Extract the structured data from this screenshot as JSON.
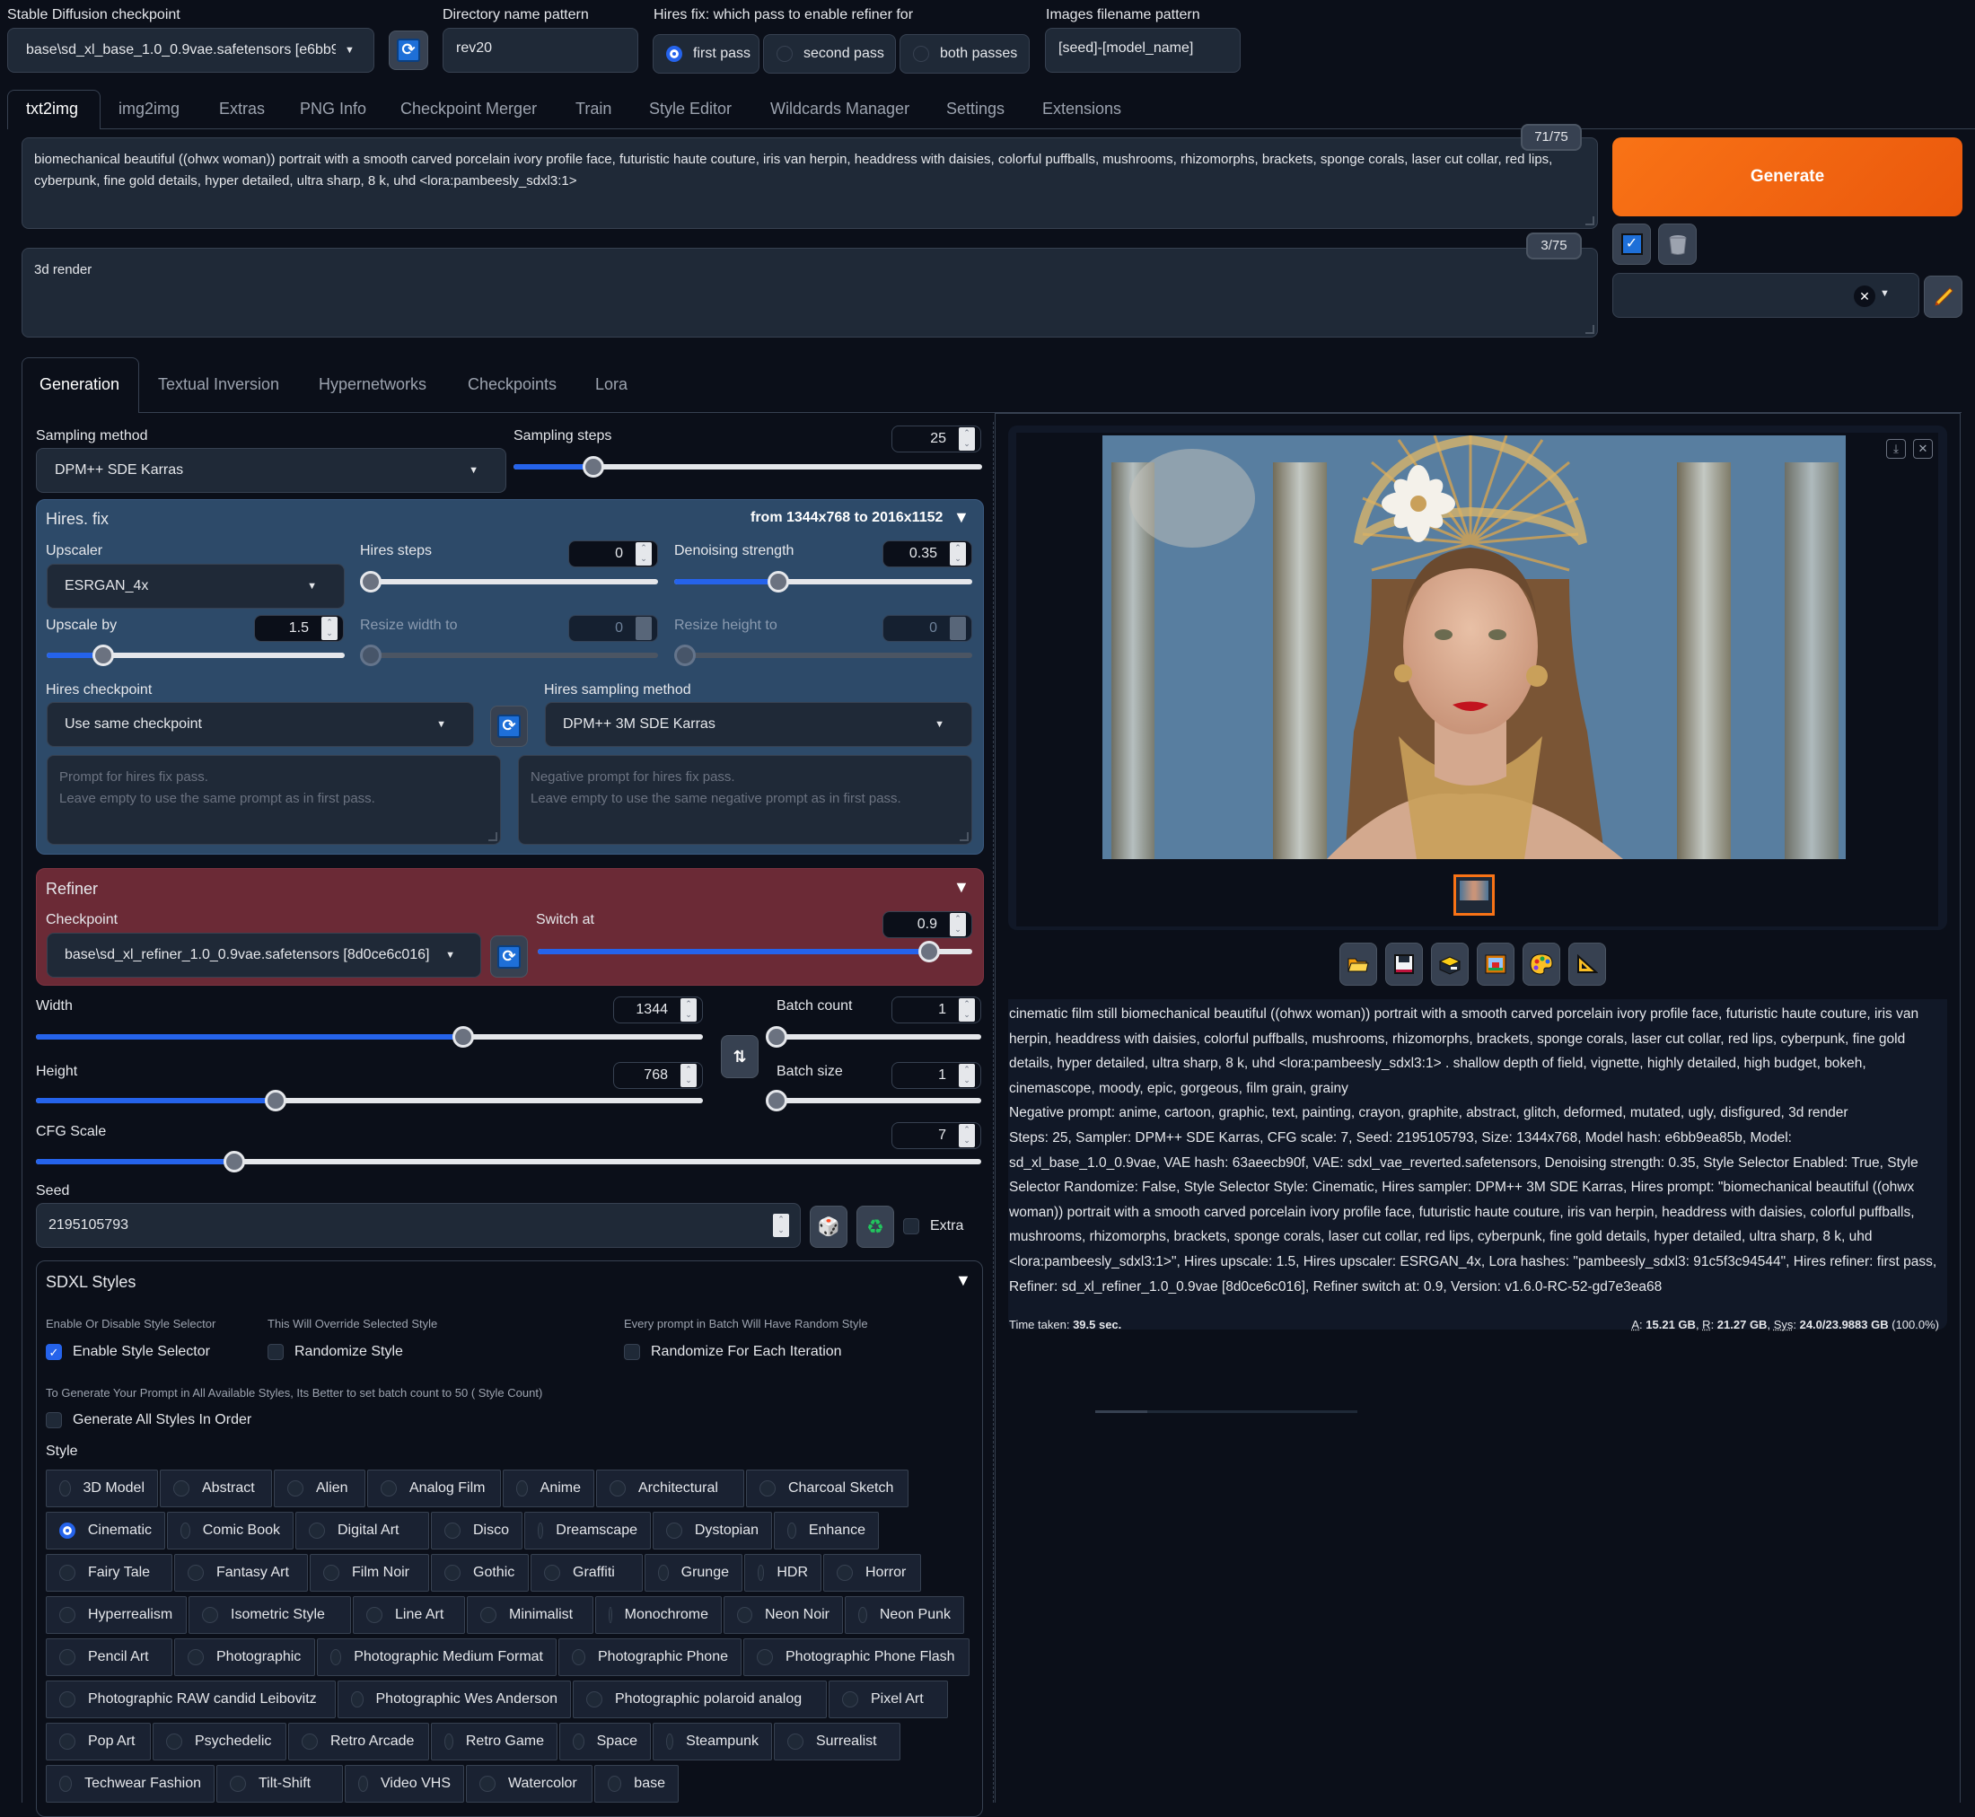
{
  "top": {
    "checkpoint_label": "Stable Diffusion checkpoint",
    "checkpoint_value": "base\\sd_xl_base_1.0_0.9vae.safetensors [e6bb9",
    "dir_label": "Directory name pattern",
    "dir_value": "rev20",
    "refiner_pass_label": "Hires fix: which pass to enable refiner for",
    "refiner_pass_options": [
      "first pass",
      "second pass",
      "both passes"
    ],
    "refiner_pass_selected": "first pass",
    "filename_label": "Images filename pattern",
    "filename_value": "[seed]-[model_name]"
  },
  "tabs": [
    "txt2img",
    "img2img",
    "Extras",
    "PNG Info",
    "Checkpoint Merger",
    "Train",
    "Style Editor",
    "Wildcards Manager",
    "Settings",
    "Extensions"
  ],
  "active_tab": "txt2img",
  "prompt": {
    "text": "biomechanical beautiful  ((ohwx woman)) portrait with a smooth carved porcelain ivory profile face, futuristic haute couture, iris van herpin, headdress with daisies, colorful puffballs, mushrooms, rhizomorphs, brackets, sponge corals, laser cut collar, red lips, cyberpunk, fine gold details, hyper detailed, ultra sharp, 8 k, uhd <lora:pambeesly_sdxl3:1>",
    "token_count": "71/75"
  },
  "negative_prompt": {
    "text": "3d render",
    "token_count": "3/75"
  },
  "generate_label": "Generate",
  "colors": {
    "accent": "#f97316",
    "primary": "#2563eb",
    "hires_bg": "#2d4a69",
    "refiner_bg": "#6b2a36"
  },
  "subtabs": [
    "Generation",
    "Textual Inversion",
    "Hypernetworks",
    "Checkpoints",
    "Lora"
  ],
  "active_subtab": "Generation",
  "sampling": {
    "method_label": "Sampling method",
    "method_value": "DPM++ SDE Karras",
    "steps_label": "Sampling steps",
    "steps_value": "25",
    "steps_fraction": 0.17
  },
  "hires": {
    "title": "Hires. fix",
    "summary": "from 1344x768  to 2016x1152",
    "upscaler_label": "Upscaler",
    "upscaler_value": "ESRGAN_4x",
    "steps_label": "Hires steps",
    "steps_value": "0",
    "steps_fraction": 0.0,
    "denoise_label": "Denoising strength",
    "denoise_value": "0.35",
    "denoise_fraction": 0.35,
    "upscale_by_label": "Upscale by",
    "upscale_by_value": "1.5",
    "upscale_by_fraction": 0.19,
    "resize_w_label": "Resize width to",
    "resize_w_value": "0",
    "resize_h_label": "Resize height to",
    "resize_h_value": "0",
    "checkpoint_label": "Hires checkpoint",
    "checkpoint_value": "Use same checkpoint",
    "sampler_label": "Hires sampling method",
    "sampler_value": "DPM++ 3M SDE Karras",
    "prompt_placeholder_1": "Prompt for hires fix pass.",
    "prompt_placeholder_2": "Leave empty to use the same prompt as in first pass.",
    "neg_placeholder_1": "Negative prompt for hires fix pass.",
    "neg_placeholder_2": "Leave empty to use the same negative prompt as in first pass."
  },
  "refiner": {
    "title": "Refiner",
    "checkpoint_label": "Checkpoint",
    "checkpoint_value": "base\\sd_xl_refiner_1.0_0.9vae.safetensors [8d0ce6c016]",
    "switch_label": "Switch at",
    "switch_value": "0.9",
    "switch_fraction": 0.9
  },
  "dims": {
    "width_label": "Width",
    "width_value": "1344",
    "width_fraction": 0.64,
    "height_label": "Height",
    "height_value": "768",
    "height_fraction": 0.36,
    "batch_count_label": "Batch count",
    "batch_count_value": "1",
    "batch_size_label": "Batch size",
    "batch_size_value": "1",
    "cfg_label": "CFG Scale",
    "cfg_value": "7",
    "cfg_fraction": 0.21,
    "seed_label": "Seed",
    "seed_value": "2195105793",
    "extra_label": "Extra"
  },
  "sdxl_styles": {
    "title": "SDXL Styles",
    "enable_hint": "Enable Or Disable Style Selector",
    "enable_label": "Enable Style Selector",
    "override_hint": "This Will Override Selected Style",
    "randomize_label": "Randomize Style",
    "batch_hint": "Every prompt in Batch Will Have Random Style",
    "randomize_each_label": "Randomize For Each Iteration",
    "all_hint": "To Generate Your Prompt in All Available Styles, Its Better to set batch count to 50 ( Style Count)",
    "all_label": "Generate All Styles In Order",
    "style_label": "Style",
    "selected": "Cinematic",
    "rows": [
      [
        "3D Model",
        "Abstract",
        "Alien",
        "Analog Film",
        "Anime",
        "Architectural",
        "Charcoal Sketch"
      ],
      [
        "Cinematic",
        "Comic Book",
        "Digital Art",
        "Disco",
        "Dreamscape",
        "Dystopian",
        "Enhance"
      ],
      [
        "Fairy Tale",
        "Fantasy Art",
        "Film Noir",
        "Gothic",
        "Graffiti",
        "Grunge",
        "HDR",
        "Horror"
      ],
      [
        "Hyperrealism",
        "Isometric Style",
        "Line Art",
        "Minimalist",
        "Monochrome",
        "Neon Noir",
        "Neon Punk"
      ],
      [
        "Pencil Art",
        "Photographic",
        "Photographic Medium Format",
        "Photographic Phone",
        "Photographic Phone Flash"
      ],
      [
        "Photographic RAW candid Leibovitz",
        "Photographic Wes Anderson",
        "Photographic polaroid analog",
        "Pixel Art"
      ],
      [
        "Pop Art",
        "Psychedelic",
        "Retro Arcade",
        "Retro Game",
        "Space",
        "Steampunk",
        "Surrealist"
      ],
      [
        "Techwear Fashion",
        "Tilt-Shift",
        "Video VHS",
        "Watercolor",
        "base"
      ]
    ]
  },
  "output": {
    "info_positive": "cinematic film still biomechanical beautiful ((ohwx woman)) portrait with a smooth carved porcelain ivory profile face, futuristic haute couture, iris van herpin, headdress with daisies, colorful puffballs, mushrooms, rhizomorphs, brackets, sponge corals, laser cut collar, red lips, cyberpunk, fine gold details, hyper detailed, ultra sharp, 8 k, uhd <lora:pambeesly_sdxl3:1> . shallow depth of field, vignette, highly detailed, high budget, bokeh, cinemascope, moody, epic, gorgeous, film grain, grainy",
    "info_negative": "Negative prompt: anime, cartoon, graphic, text, painting, crayon, graphite, abstract, glitch, deformed, mutated, ugly, disfigured, 3d render",
    "info_params": "Steps: 25, Sampler: DPM++ SDE Karras, CFG scale: 7, Seed: 2195105793, Size: 1344x768, Model hash: e6bb9ea85b, Model: sd_xl_base_1.0_0.9vae, VAE hash: 63aeecb90f, VAE: sdxl_vae_reverted.safetensors, Denoising strength: 0.35, Style Selector Enabled: True, Style Selector Randomize: False, Style Selector Style: Cinematic, Hires sampler: DPM++ 3M SDE Karras, Hires prompt: \"biomechanical beautiful ((ohwx woman)) portrait with a smooth carved porcelain ivory profile face, futuristic haute couture, iris van herpin, headdress with daisies, colorful puffballs, mushrooms, rhizomorphs, brackets, sponge corals, laser cut collar, red lips, cyberpunk, fine gold details, hyper detailed, ultra sharp, 8 k, uhd <lora:pambeesly_sdxl3:1>\", Hires upscale: 1.5, Hires upscaler: ESRGAN_4x, Lora hashes: \"pambeesly_sdxl3: 91c5f3c94544\", Hires refiner: first pass, Refiner: sd_xl_refiner_1.0_0.9vae [8d0ce6c016], Refiner switch at: 0.9, Version: v1.6.0-RC-52-gd7e3ea68",
    "time_label": "Time taken:",
    "time_value": "39.5 sec.",
    "mem_a_label": "A",
    "mem_a": "15.21 GB",
    "mem_r_label": "R",
    "mem_r": "21.27 GB",
    "mem_sys_label": "Sys",
    "mem_sys": "24.0/23.9883 GB",
    "mem_pct": "(100.0%)",
    "image_alt": "Generated portrait: woman with gold sunburst headdress and white daisy, red lips, gold necklace, blurred blue pillars background",
    "tools": [
      "folder-icon",
      "save-icon",
      "zip-icon",
      "send-to-img2img-icon",
      "send-to-inpaint-icon",
      "send-to-extras-icon"
    ]
  }
}
